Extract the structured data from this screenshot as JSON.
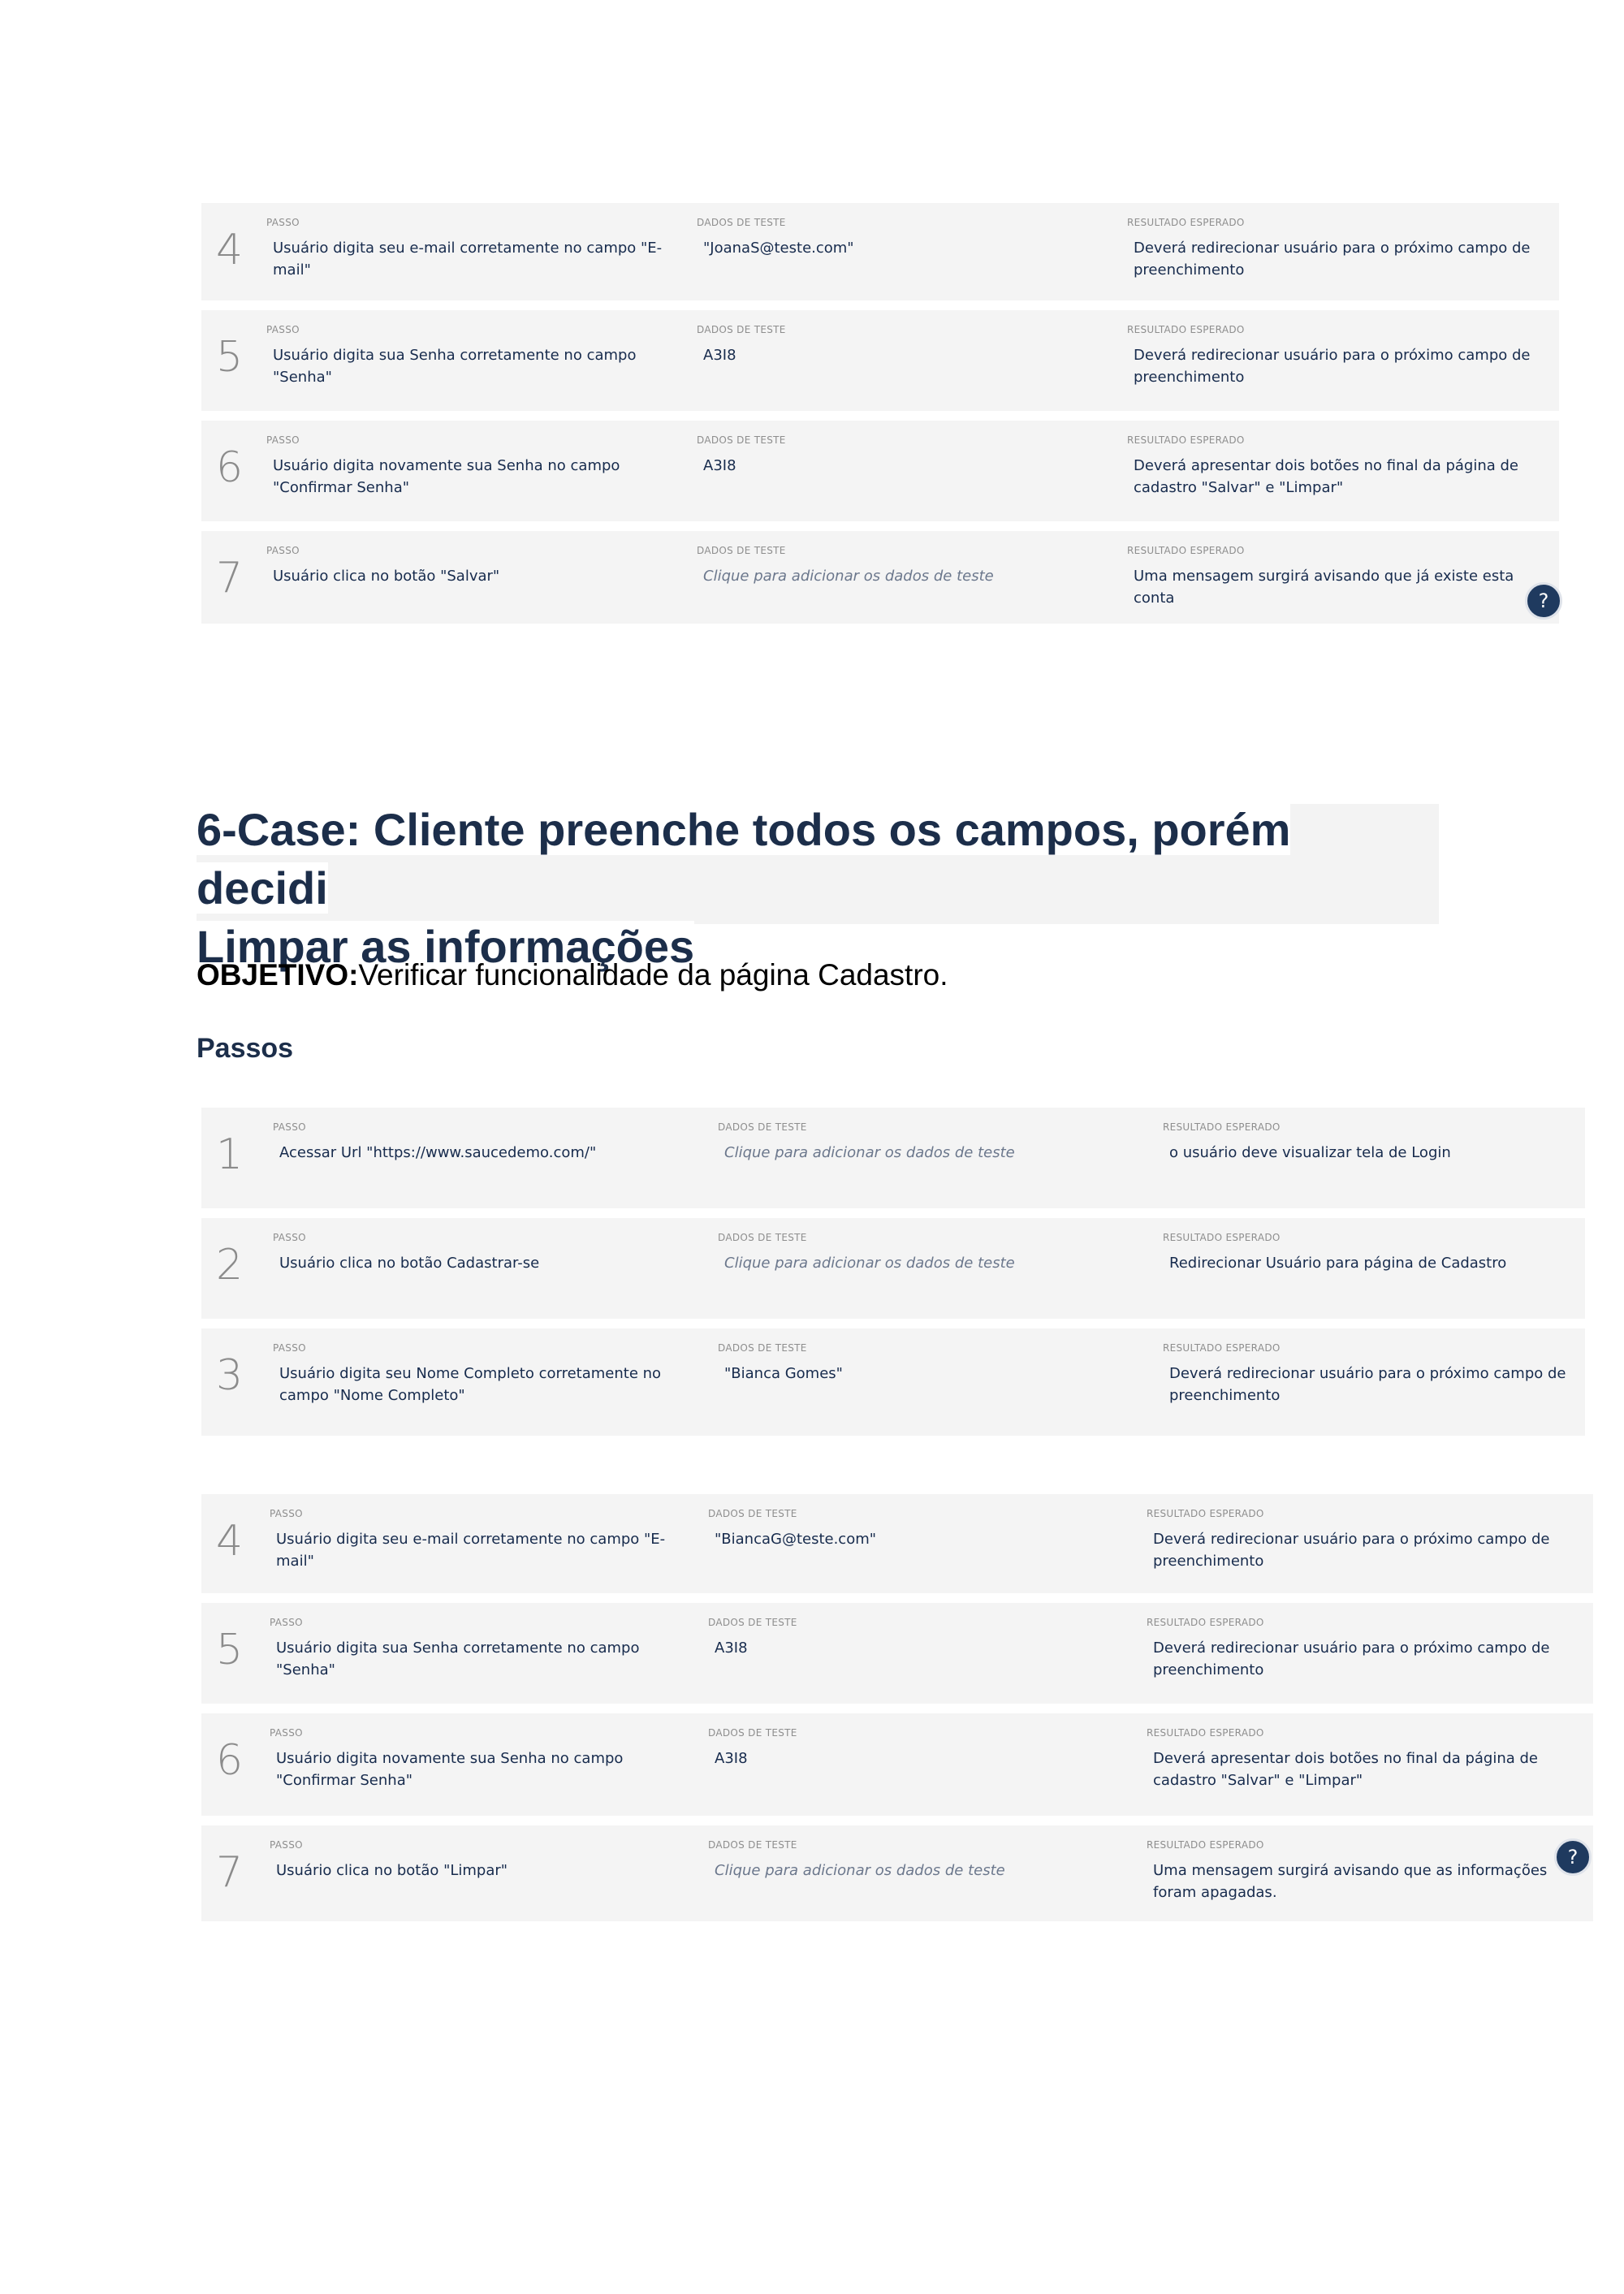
{
  "labels": {
    "passo": "PASSO",
    "dados": "DADOS DE TESTE",
    "resultado": "RESULTADO ESPERADO"
  },
  "help_icon": "question-mark-icon",
  "table_top": [
    {
      "num": "4",
      "passo": "Usuário digita seu e-mail corretamente no campo \"E-mail\"",
      "dados": "\"JoanaS@teste.com\"",
      "resultado": "Deverá redirecionar usuário para o próximo campo de preenchimento"
    },
    {
      "num": "5",
      "passo": "Usuário digita sua Senha corretamente no campo \"Senha\"",
      "dados": "A3I8",
      "resultado": "Deverá redirecionar usuário para o próximo campo de preenchimento"
    },
    {
      "num": "6",
      "passo": "Usuário digita novamente sua Senha no campo \"Confirmar Senha\"",
      "dados": "A3I8",
      "resultado": "Deverá apresentar dois botões no final da página de cadastro \"Salvar\" e \"Limpar\""
    },
    {
      "num": "7",
      "passo": "Usuário clica no botão \"Salvar\"",
      "dados": "Clique para adicionar os dados de teste",
      "resultado": "Uma mensagem surgirá avisando que já existe esta conta"
    }
  ],
  "case": {
    "title_line1": "6-Case: Cliente preenche todos os campos, porém decidi",
    "title_line2": "Limpar as informações",
    "objective_label": "OBJETIVO:",
    "objective_text": "Verificar funcionalidade da página Cadastro.",
    "passos_heading": "Passos"
  },
  "table_mid": [
    {
      "num": "1",
      "passo": "Acessar Url \"https://www.saucedemo.com/\"",
      "dados": "Clique para adicionar os dados de teste",
      "resultado": "o usuário deve visualizar tela de Login"
    },
    {
      "num": "2",
      "passo": "Usuário clica no botão Cadastrar-se",
      "dados": "Clique para adicionar os dados de teste",
      "resultado": "Redirecionar Usuário para página de Cadastro"
    },
    {
      "num": "3",
      "passo": "Usuário digita seu Nome Completo corretamente no campo \"Nome Completo\"",
      "dados": "\"Bianca Gomes\"",
      "resultado": "Deverá redirecionar usuário para o próximo campo de preenchimento"
    }
  ],
  "table_bottom": [
    {
      "num": "4",
      "passo": "Usuário digita seu e-mail corretamente no campo \"E-mail\"",
      "dados": "\"BiancaG@teste.com\"",
      "resultado": "Deverá redirecionar usuário para o próximo campo de preenchimento"
    },
    {
      "num": "5",
      "passo": "Usuário digita sua Senha corretamente no campo \"Senha\"",
      "dados": "A3I8",
      "resultado": "Deverá redirecionar usuário para o próximo campo de preenchimento"
    },
    {
      "num": "6",
      "passo": "Usuário digita novamente sua Senha no campo \"Confirmar Senha\"",
      "dados": "A3I8",
      "resultado": "Deverá apresentar dois botões no final da página de cadastro \"Salvar\" e \"Limpar\""
    },
    {
      "num": "7",
      "passo": "Usuário clica no botão \"Limpar\"",
      "dados": "Clique para adicionar os dados de teste",
      "resultado": "Uma mensagem surgirá avisando que as informações foram apagadas."
    }
  ]
}
